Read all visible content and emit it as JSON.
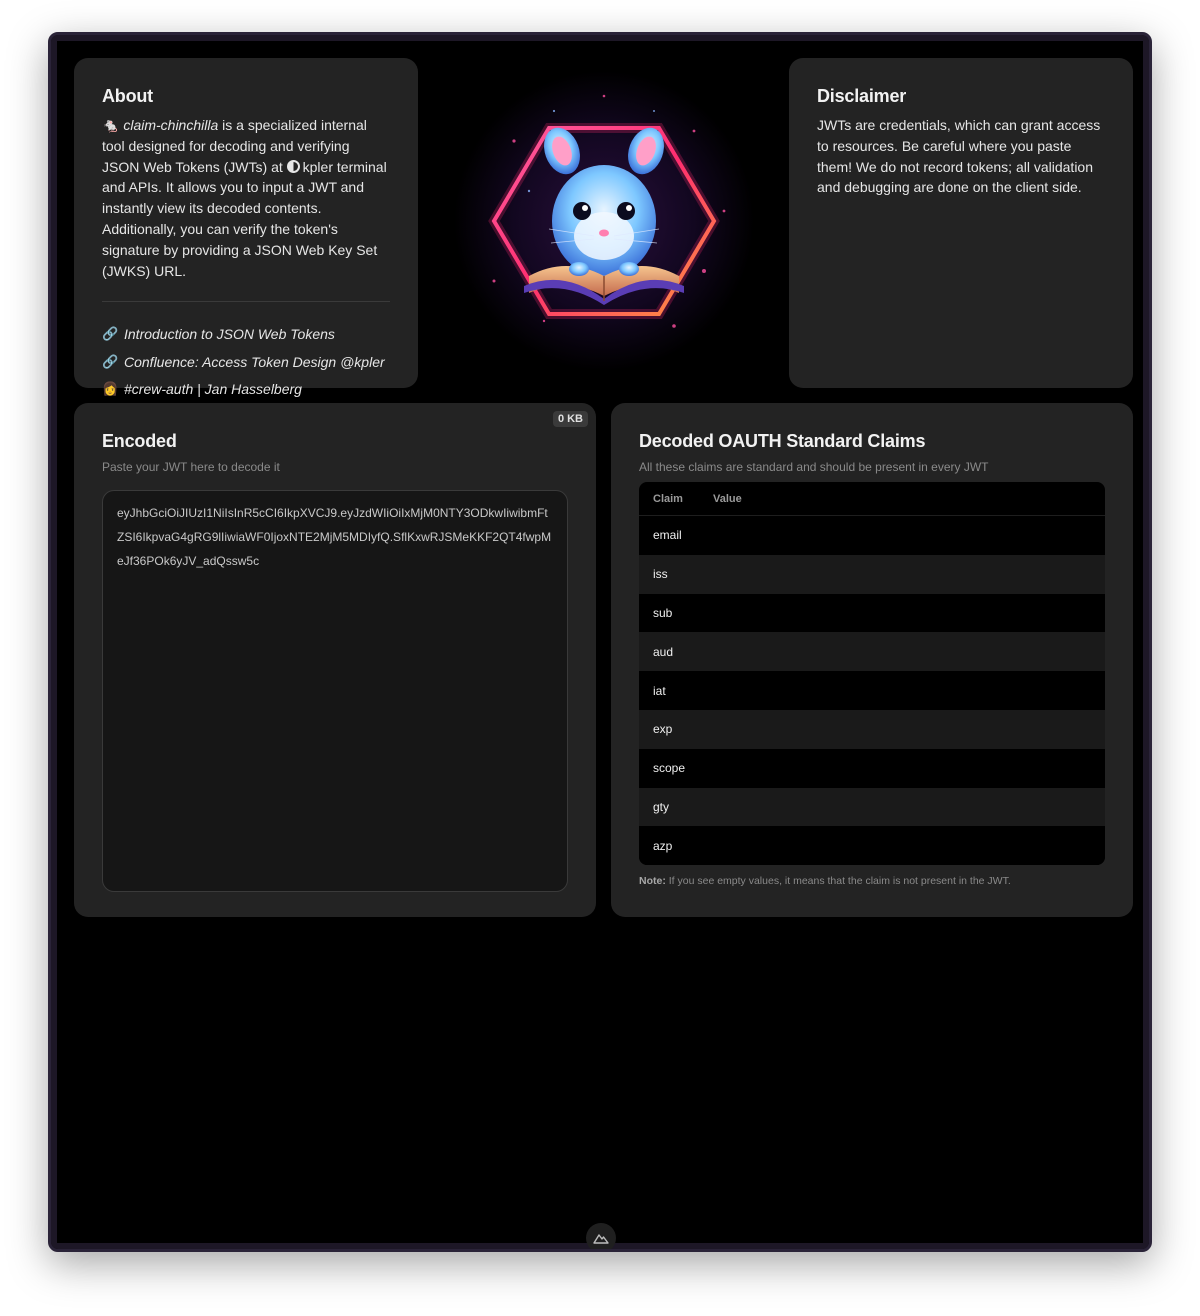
{
  "about": {
    "title": "About",
    "tool_name": "claim-chinchilla",
    "desc_part1": " is a specialized internal tool designed for decoding and verifying JSON Web Tokens (JWTs) at ",
    "company": "kpler",
    "desc_part2": " terminal and APIs. It allows you to input a JWT and instantly view its decoded contents. Additionally, you can verify the token's signature by providing a JSON Web Key Set (JWKS) URL.",
    "links": [
      {
        "icon": "link-icon",
        "label": "Introduction to JSON Web Tokens"
      },
      {
        "icon": "link-icon",
        "label": "Confluence: Access Token Design @kpler"
      },
      {
        "icon": "person-icon",
        "label": "#crew-auth | Jan Hasselberg"
      }
    ]
  },
  "disclaimer": {
    "title": "Disclaimer",
    "text": "JWTs are credentials, which can grant access to resources. Be careful where you paste them! We do not record tokens; all validation and debugging are done on the client side."
  },
  "encoded": {
    "title": "Encoded",
    "subtitle": "Paste your JWT here to decode it",
    "size_badge": "0 KB",
    "token": "eyJhbGciOiJIUzI1NiIsInR5cCI6IkpXVCJ9.eyJzdWIiOiIxMjM0NTY3ODkwIiwibmFtZSI6IkpvaG4gRG9lIiwiaWF0IjoxNTE2MjM5MDIyfQ.SflKxwRJSMeKKF2QT4fwpMeJf36POk6yJV_adQssw5c"
  },
  "decoded": {
    "title": "Decoded OAUTH Standard Claims",
    "subtitle": "All these claims are standard and should be present in every JWT",
    "col_claim": "Claim",
    "col_value": "Value",
    "claims": [
      "email",
      "iss",
      "sub",
      "aud",
      "iat",
      "exp",
      "scope",
      "gty",
      "azp"
    ],
    "note_label": "Note:",
    "note_text": " If you see empty values, it means that the claim is not present in the JWT."
  },
  "colors": {
    "accent_neon_pink": "#ff3d8a",
    "accent_neon_orange": "#ff9a3c",
    "card_bg": "#232323"
  }
}
